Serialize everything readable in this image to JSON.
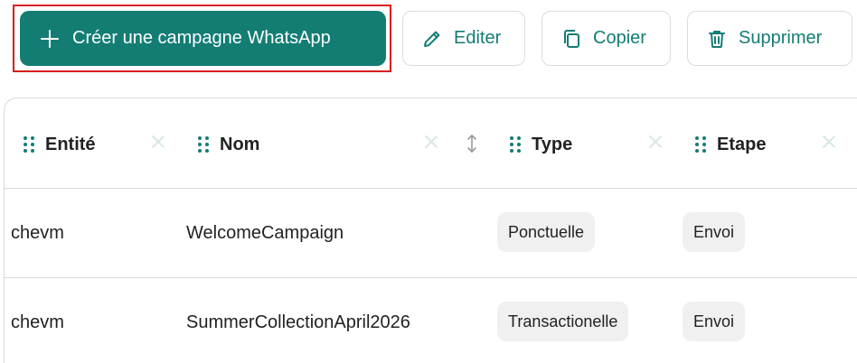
{
  "toolbar": {
    "create_label": "Créer une campagne WhatsApp",
    "edit_label": "Editer",
    "copy_label": "Copier",
    "delete_label": "Supprimer"
  },
  "table": {
    "columns": [
      "Entité",
      "Nom",
      "Type",
      "Etape"
    ],
    "rows": [
      {
        "entite": "chevm",
        "nom": "WelcomeCampaign",
        "type": "Ponctuelle",
        "etape": "Envoi"
      },
      {
        "entite": "chevm",
        "nom": "SummerCollectionApril2026",
        "type": "Transactionelle",
        "etape": "Envoi"
      }
    ]
  },
  "colors": {
    "accent": "#137d74",
    "highlight": "#d81e1e",
    "chip_bg": "#f0f0f0"
  },
  "icons": [
    "plus-icon",
    "pencil-icon",
    "copy-icon",
    "trash-icon",
    "drag-handle-icon",
    "close-icon",
    "sort-icon"
  ]
}
